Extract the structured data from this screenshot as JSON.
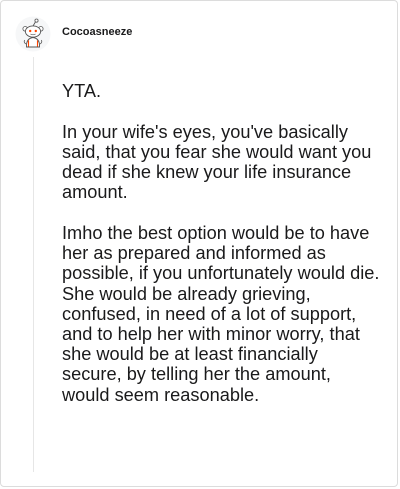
{
  "comment": {
    "username": "Cocoasneeze",
    "avatar_icon": "snoo-avatar-icon",
    "paragraphs": [
      "YTA.",
      "In your wife's eyes, you've basically said, that you fear she would want you dead if she knew your life insurance amount.",
      "Imho the best option would be to have her as prepared and informed as possible, if you unfortunately would die. She would be already grieving, confused, in need of a lot of support, and to help her with minor worry, that she would be at least financially secure, by telling her the amount, would seem reasonable."
    ]
  },
  "colors": {
    "text": "#1a1a1b",
    "border": "#dcdcdc",
    "thread_line": "#e6e6e6",
    "avatar_accent": "#ff4500"
  }
}
